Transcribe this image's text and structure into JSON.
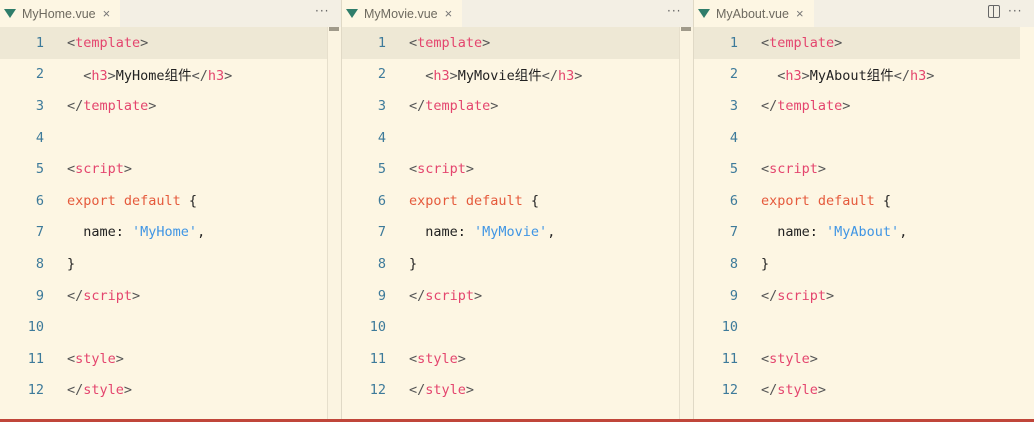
{
  "colors": {
    "background": "#fdf6e3",
    "current_line": "#eee8d5",
    "tag": "#e4456e",
    "keyword": "#e55a3c",
    "string": "#3f95e4",
    "line_number": "#3d7a9a",
    "bottom_bar": "#c0463a"
  },
  "panes": [
    {
      "tab": {
        "icon": "vue-icon",
        "label": "MyHome.vue",
        "close": "×"
      },
      "more": "···",
      "lines": [
        {
          "n": "1",
          "tokens": [
            [
              "br",
              "<"
            ],
            [
              "tag",
              "template"
            ],
            [
              "br",
              ">"
            ]
          ]
        },
        {
          "n": "2",
          "tokens": [
            [
              "br",
              "  <"
            ],
            [
              "tag",
              "h3"
            ],
            [
              "br",
              ">"
            ],
            [
              "txt",
              "MyHome组件"
            ],
            [
              "br",
              "</"
            ],
            [
              "tag",
              "h3"
            ],
            [
              "br",
              ">"
            ]
          ]
        },
        {
          "n": "3",
          "tokens": [
            [
              "br",
              "</"
            ],
            [
              "tag",
              "template"
            ],
            [
              "br",
              ">"
            ]
          ]
        },
        {
          "n": "4",
          "tokens": []
        },
        {
          "n": "5",
          "tokens": [
            [
              "br",
              "<"
            ],
            [
              "tag",
              "script"
            ],
            [
              "br",
              ">"
            ]
          ]
        },
        {
          "n": "6",
          "tokens": [
            [
              "kw",
              "export default"
            ],
            [
              "txt",
              " {"
            ]
          ]
        },
        {
          "n": "7",
          "tokens": [
            [
              "txt",
              "  name: "
            ],
            [
              "str",
              "'MyHome'"
            ],
            [
              "txt",
              ","
            ]
          ]
        },
        {
          "n": "8",
          "tokens": [
            [
              "txt",
              "}"
            ]
          ]
        },
        {
          "n": "9",
          "tokens": [
            [
              "br",
              "</"
            ],
            [
              "tag",
              "script"
            ],
            [
              "br",
              ">"
            ]
          ]
        },
        {
          "n": "10",
          "tokens": []
        },
        {
          "n": "11",
          "tokens": [
            [
              "br",
              "<"
            ],
            [
              "tag",
              "style"
            ],
            [
              "br",
              ">"
            ]
          ]
        },
        {
          "n": "12",
          "tokens": [
            [
              "br",
              "</"
            ],
            [
              "tag",
              "style"
            ],
            [
              "br",
              ">"
            ]
          ]
        }
      ]
    },
    {
      "tab": {
        "icon": "vue-icon",
        "label": "MyMovie.vue",
        "close": "×"
      },
      "more": "···",
      "lines": [
        {
          "n": "1",
          "tokens": [
            [
              "br",
              "<"
            ],
            [
              "tag",
              "template"
            ],
            [
              "br",
              ">"
            ]
          ]
        },
        {
          "n": "2",
          "tokens": [
            [
              "br",
              "  <"
            ],
            [
              "tag",
              "h3"
            ],
            [
              "br",
              ">"
            ],
            [
              "txt",
              "MyMovie组件"
            ],
            [
              "br",
              "</"
            ],
            [
              "tag",
              "h3"
            ],
            [
              "br",
              ">"
            ]
          ]
        },
        {
          "n": "3",
          "tokens": [
            [
              "br",
              "</"
            ],
            [
              "tag",
              "template"
            ],
            [
              "br",
              ">"
            ]
          ]
        },
        {
          "n": "4",
          "tokens": []
        },
        {
          "n": "5",
          "tokens": [
            [
              "br",
              "<"
            ],
            [
              "tag",
              "script"
            ],
            [
              "br",
              ">"
            ]
          ]
        },
        {
          "n": "6",
          "tokens": [
            [
              "kw",
              "export default"
            ],
            [
              "txt",
              " {"
            ]
          ]
        },
        {
          "n": "7",
          "tokens": [
            [
              "txt",
              "  name: "
            ],
            [
              "str",
              "'MyMovie'"
            ],
            [
              "txt",
              ","
            ]
          ]
        },
        {
          "n": "8",
          "tokens": [
            [
              "txt",
              "}"
            ]
          ]
        },
        {
          "n": "9",
          "tokens": [
            [
              "br",
              "</"
            ],
            [
              "tag",
              "script"
            ],
            [
              "br",
              ">"
            ]
          ]
        },
        {
          "n": "10",
          "tokens": []
        },
        {
          "n": "11",
          "tokens": [
            [
              "br",
              "<"
            ],
            [
              "tag",
              "style"
            ],
            [
              "br",
              ">"
            ]
          ]
        },
        {
          "n": "12",
          "tokens": [
            [
              "br",
              "</"
            ],
            [
              "tag",
              "style"
            ],
            [
              "br",
              ">"
            ]
          ]
        }
      ]
    },
    {
      "tab": {
        "icon": "vue-icon",
        "label": "MyAbout.vue",
        "close": "×"
      },
      "more": "···",
      "lines": [
        {
          "n": "1",
          "tokens": [
            [
              "br",
              "<"
            ],
            [
              "tag",
              "template"
            ],
            [
              "br",
              ">"
            ]
          ]
        },
        {
          "n": "2",
          "tokens": [
            [
              "br",
              "  <"
            ],
            [
              "tag",
              "h3"
            ],
            [
              "br",
              ">"
            ],
            [
              "txt",
              "MyAbout组件"
            ],
            [
              "br",
              "</"
            ],
            [
              "tag",
              "h3"
            ],
            [
              "br",
              ">"
            ]
          ]
        },
        {
          "n": "3",
          "tokens": [
            [
              "br",
              "</"
            ],
            [
              "tag",
              "template"
            ],
            [
              "br",
              ">"
            ]
          ]
        },
        {
          "n": "4",
          "tokens": []
        },
        {
          "n": "5",
          "tokens": [
            [
              "br",
              "<"
            ],
            [
              "tag",
              "script"
            ],
            [
              "br",
              ">"
            ]
          ]
        },
        {
          "n": "6",
          "tokens": [
            [
              "kw",
              "export default"
            ],
            [
              "txt",
              " {"
            ]
          ]
        },
        {
          "n": "7",
          "tokens": [
            [
              "txt",
              "  name: "
            ],
            [
              "str",
              "'MyAbout'"
            ],
            [
              "txt",
              ","
            ]
          ]
        },
        {
          "n": "8",
          "tokens": [
            [
              "txt",
              "}"
            ]
          ]
        },
        {
          "n": "9",
          "tokens": [
            [
              "br",
              "</"
            ],
            [
              "tag",
              "script"
            ],
            [
              "br",
              ">"
            ]
          ]
        },
        {
          "n": "10",
          "tokens": []
        },
        {
          "n": "11",
          "tokens": [
            [
              "br",
              "<"
            ],
            [
              "tag",
              "style"
            ],
            [
              "br",
              ">"
            ]
          ]
        },
        {
          "n": "12",
          "tokens": [
            [
              "br",
              "</"
            ],
            [
              "tag",
              "style"
            ],
            [
              "br",
              ">"
            ]
          ]
        }
      ]
    }
  ]
}
